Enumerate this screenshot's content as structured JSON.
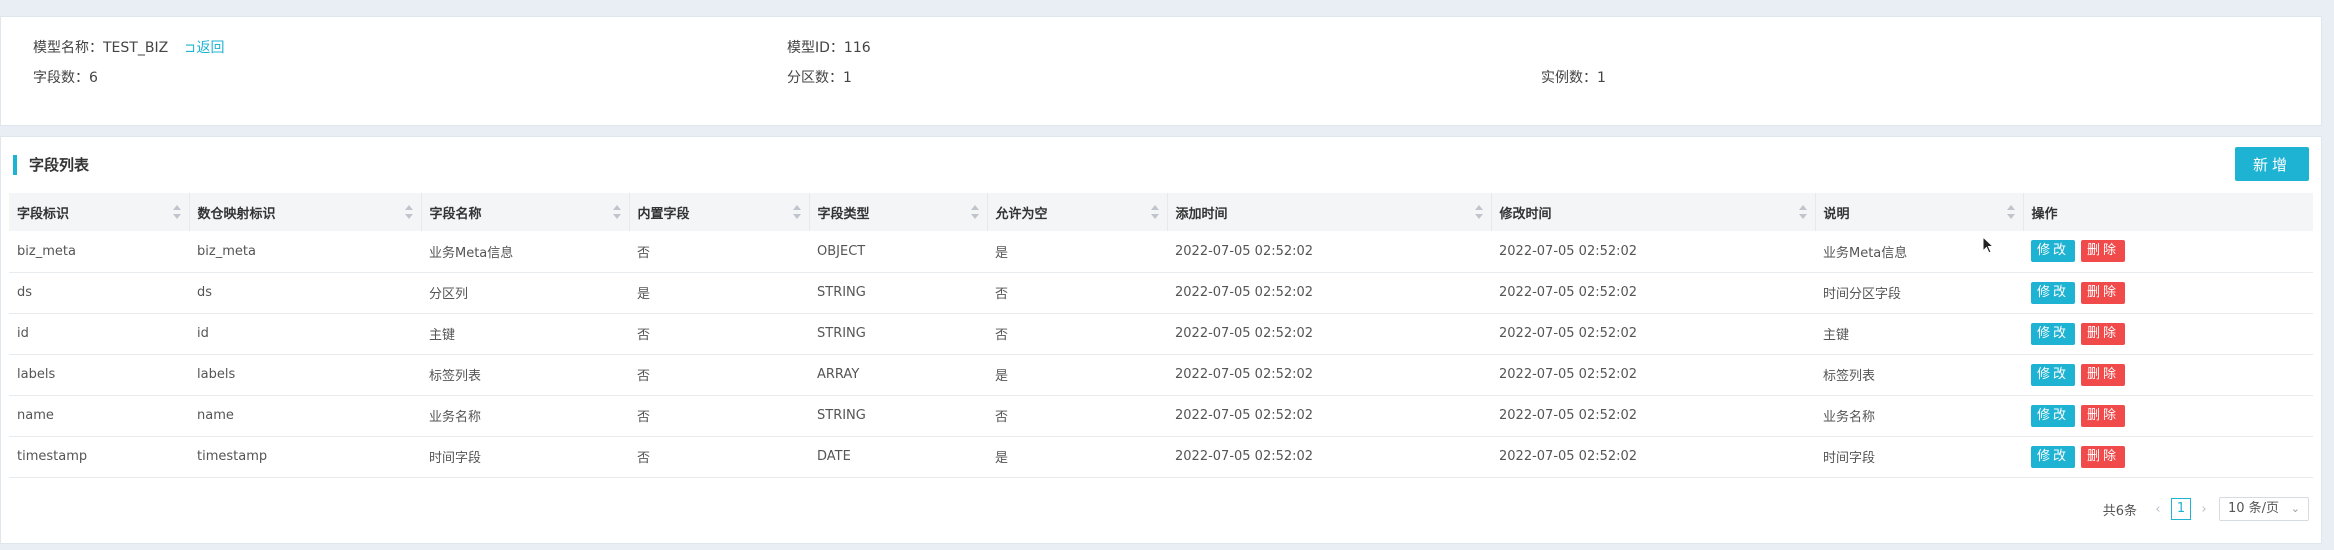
{
  "model_info": {
    "name_label": "模型名称：",
    "name_value": "TEST_BIZ",
    "back_label": "返回",
    "id_label": "模型ID：",
    "id_value": "116",
    "fields_label": "字段数：",
    "fields_value": "6",
    "partitions_label": "分区数：",
    "partitions_value": "1",
    "instances_label": "实例数：",
    "instances_value": "1"
  },
  "field_list": {
    "title": "字段列表",
    "add_label": "新增",
    "columns": [
      "字段标识",
      "数仓映射标识",
      "字段名称",
      "内置字段",
      "字段类型",
      "允许为空",
      "添加时间",
      "修改时间",
      "说明",
      "操作"
    ],
    "rows": [
      [
        "biz_meta",
        "biz_meta",
        "业务Meta信息",
        "否",
        "OBJECT",
        "是",
        "2022-07-05 02:52:02",
        "2022-07-05 02:52:02",
        "业务Meta信息"
      ],
      [
        "ds",
        "ds",
        "分区列",
        "是",
        "STRING",
        "否",
        "2022-07-05 02:52:02",
        "2022-07-05 02:52:02",
        "时间分区字段"
      ],
      [
        "id",
        "id",
        "主键",
        "否",
        "STRING",
        "否",
        "2022-07-05 02:52:02",
        "2022-07-05 02:52:02",
        "主键"
      ],
      [
        "labels",
        "labels",
        "标签列表",
        "否",
        "ARRAY",
        "是",
        "2022-07-05 02:52:02",
        "2022-07-05 02:52:02",
        "标签列表"
      ],
      [
        "name",
        "name",
        "业务名称",
        "否",
        "STRING",
        "否",
        "2022-07-05 02:52:02",
        "2022-07-05 02:52:02",
        "业务名称"
      ],
      [
        "timestamp",
        "timestamp",
        "时间字段",
        "否",
        "DATE",
        "是",
        "2022-07-05 02:52:02",
        "2022-07-05 02:52:02",
        "时间字段"
      ]
    ],
    "edit_label": "修改",
    "delete_label": "删除"
  },
  "pagination": {
    "total": "共6条",
    "current_page": "1",
    "page_size": "10 条/页"
  },
  "colors": {
    "accent": "#1fb3d3",
    "danger": "#f04a4a"
  }
}
